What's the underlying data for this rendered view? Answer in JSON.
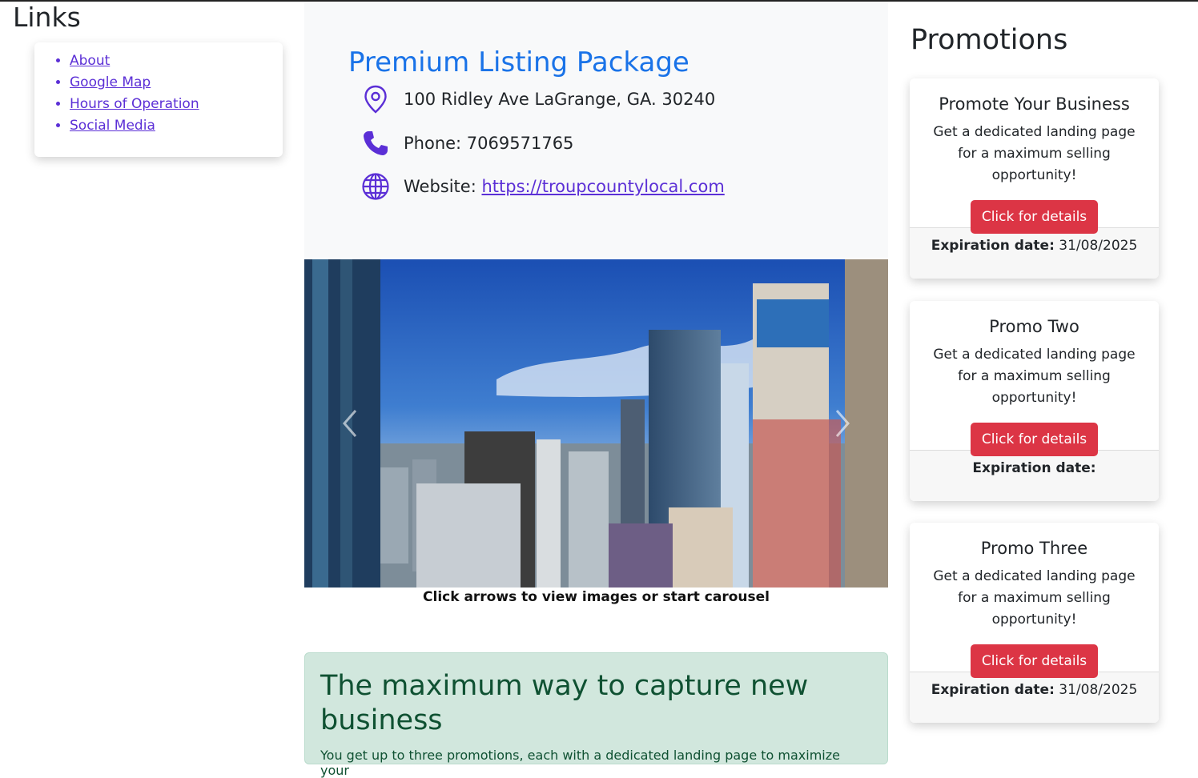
{
  "sidebar": {
    "heading": "Links",
    "links": [
      {
        "label": "About"
      },
      {
        "label": "Google Map"
      },
      {
        "label": "Hours of Operation"
      },
      {
        "label": "Social Media"
      }
    ]
  },
  "listing": {
    "title": "Premium Listing Package",
    "address": "100 Ridley Ave LaGrange, GA. 30240",
    "phone": "Phone: 7069571765",
    "website_label": "Website: ",
    "website_url": "https://troupcountylocal.com"
  },
  "carousel": {
    "caption": "Click arrows to view images or start carousel",
    "prev_icon": "chevron-left-icon",
    "next_icon": "chevron-right-icon"
  },
  "alert": {
    "heading": "The maximum way to capture new business",
    "text": "You get up to three promotions, each with a dedicated landing page to maximize your"
  },
  "promotions": {
    "heading": "Promotions",
    "expiration_label": "Expiration date:",
    "cards": [
      {
        "title": "Promote Your Business",
        "description": "Get a dedicated landing page for a maximum selling opportunity!",
        "button": "Click for details",
        "expiration": " 31/08/2025"
      },
      {
        "title": "Promo Two",
        "description": "Get a dedicated landing page for a maximum selling opportunity!",
        "button": "Click for details",
        "expiration": ""
      },
      {
        "title": "Promo Three",
        "description": "Get a dedicated landing page for a maximum selling opportunity!",
        "button": "Click for details",
        "expiration": " 31/08/2025"
      }
    ]
  },
  "colors": {
    "title_blue": "#1a73e8",
    "icon_purple": "#5b2fd6",
    "button_red": "#dc3545",
    "alert_green_bg": "#d1e7dd",
    "alert_green_text": "#0f5132"
  }
}
